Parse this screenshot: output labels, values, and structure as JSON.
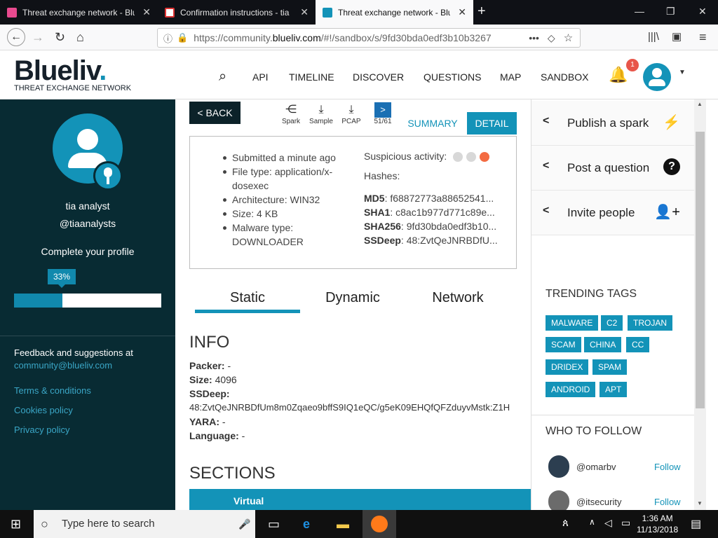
{
  "browser": {
    "tabs": [
      {
        "label": "Threat exchange network - Blu",
        "active": false
      },
      {
        "label": "Confirmation instructions - tia",
        "active": false
      },
      {
        "label": "Threat exchange network - Blu",
        "active": true
      }
    ],
    "url_prefix": "https://community.",
    "url_domain": "blueliv.com",
    "url_suffix": "/#!/sandbox/s/9fd30bda0edf3b10b3267",
    "accent": "#1393b8"
  },
  "site": {
    "logo_word": "Blueliv",
    "logo_dot": ".",
    "logo_sub": "THREAT EXCHANGE NETWORK",
    "nav": [
      "API",
      "TIMELINE",
      "DISCOVER",
      "QUESTIONS",
      "MAP",
      "SANDBOX"
    ],
    "notification_count": "1"
  },
  "profile": {
    "name": "tia analyst",
    "handle": "@tiaanalysts",
    "complete_label": "Complete your profile",
    "progress_label": "33%",
    "progress_fraction": 0.33,
    "feedback_text": "Feedback and suggestions at",
    "feedback_email": "community@blueliv.com",
    "links": [
      "Terms & conditions",
      "Cookies policy",
      "Privacy policy"
    ]
  },
  "sandbox": {
    "back_label": "< BACK",
    "tools": [
      "Spark",
      "Sample",
      "PCAP",
      "51/61"
    ],
    "summary_tab": "SUMMARY",
    "detail_tab": "DETAIL",
    "details": [
      "Submitted a minute ago",
      "File type: application/x-dosexec",
      "Architecture: WIN32",
      "Size: 4 KB",
      "Malware type: DOWNLOADER"
    ],
    "suspicious_label": "Suspicious activity:",
    "hashes_label": "Hashes:",
    "hashes": [
      {
        "k": "MD5",
        "v": ": f68872773a88652541..."
      },
      {
        "k": "SHA1",
        "v": ": c8ac1b977d771c89e..."
      },
      {
        "k": "SHA256",
        "v": ": 9fd30bda0edf3b10..."
      },
      {
        "k": "SSDeep",
        "v": ": 48:ZvtQeJNRBDfU..."
      }
    ],
    "subtabs": [
      "Static",
      "Dynamic",
      "Network"
    ],
    "info_title": "INFO",
    "info": {
      "packer_k": "Packer:",
      "packer_v": " -",
      "size_k": "Size:",
      "size_v": " 4096",
      "ssdeep_k": "SSDeep:",
      "ssdeep_v": "48:ZvtQeJNRBDfUm8m0Zqaeo9bffS9IQ1eQC/g5eK09EHQfQFZduyvMstk:Z1H",
      "yara_k": "YARA:",
      "yara_v": " -",
      "lang_k": "Language:",
      "lang_v": " -"
    },
    "sections_title": "SECTIONS",
    "sections_col": "Virtual"
  },
  "sidebar_right": {
    "actions": [
      "Publish a spark",
      "Post a question",
      "Invite people"
    ],
    "trending_title": "TRENDING TAGS",
    "tags": [
      "MALWARE",
      "C2",
      "TROJAN",
      "SCAM",
      "CHINA",
      "CC",
      "DRIDEX",
      "SPAM",
      "ANDROID",
      "APT"
    ],
    "follow_title": "WHO TO FOLLOW",
    "follow": [
      {
        "name": "@omarbv",
        "btn": "Follow"
      },
      {
        "name": "@itsecurity",
        "btn": "Follow"
      }
    ]
  },
  "taskbar": {
    "search_placeholder": "Type here to search",
    "time": "1:36 AM",
    "date": "11/13/2018"
  }
}
